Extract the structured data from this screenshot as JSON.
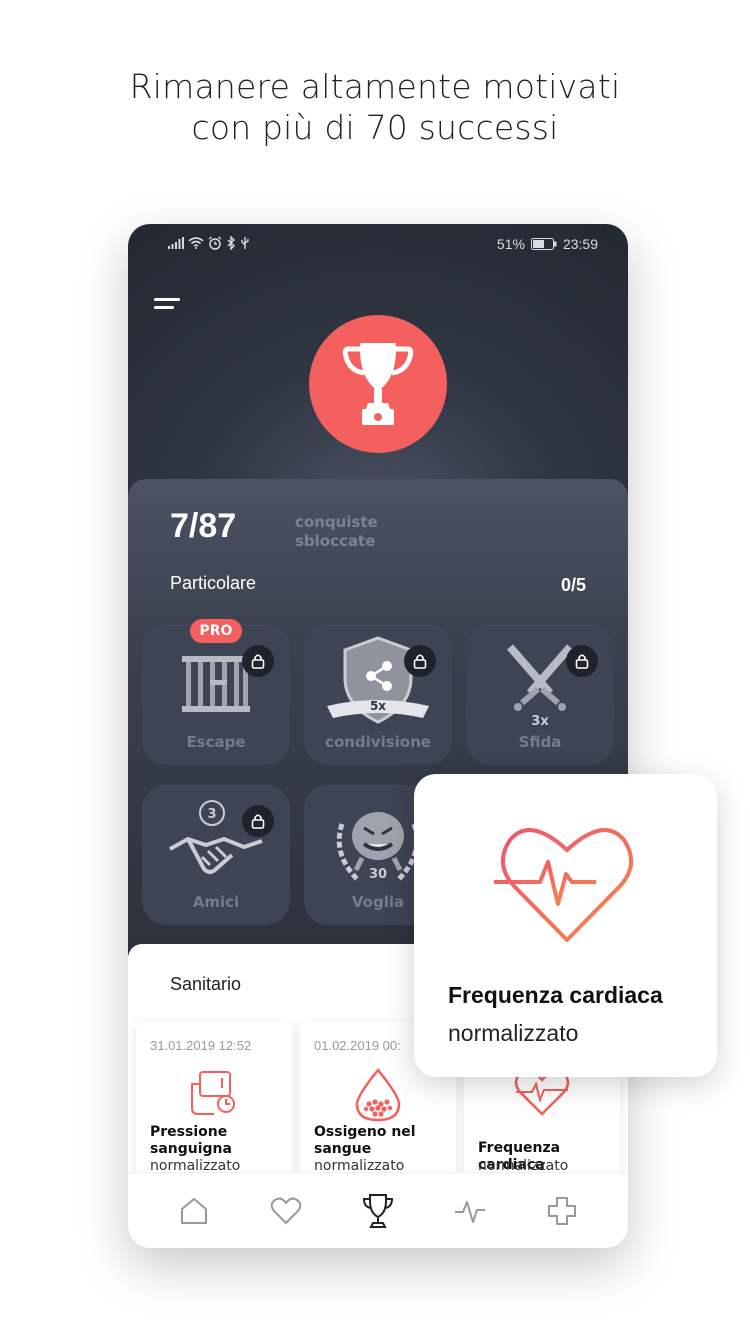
{
  "headline": {
    "line1": "Rimanere altamente motivati",
    "line2": "con più di 70 successi"
  },
  "status_bar": {
    "battery": "51%",
    "time": "23:59"
  },
  "achievements": {
    "count": "7/87",
    "count_label": "conquiste sbloccate",
    "section_title": "Particolare",
    "section_count": "0/5",
    "badges": [
      {
        "name": "Escape",
        "pro_label": "PRO",
        "locked": true
      },
      {
        "name": "condivisione",
        "multiplier": "5x",
        "locked": true
      },
      {
        "name": "Sfida",
        "multiplier": "3x",
        "locked": true
      },
      {
        "name": "Amici",
        "count": "3",
        "locked": true
      },
      {
        "name": "Voglia",
        "count": "30",
        "locked": true
      }
    ]
  },
  "health": {
    "title": "Sanitario",
    "cards": [
      {
        "date": "31.01.2019 12:52",
        "title": "Pressione sanguigna",
        "subtitle": "normalizzato",
        "icon": "blood-pressure-icon"
      },
      {
        "date": "01.02.2019 00:",
        "title": "Ossigeno nel sangue",
        "subtitle": "normalizzato",
        "icon": "blood-drop-icon"
      },
      {
        "date": "",
        "title": "Frequenza cardiaca",
        "subtitle": "normalizzato",
        "icon": "heart-rate-icon"
      }
    ]
  },
  "overlay": {
    "title": "Frequenza cardiaca",
    "subtitle": "normalizzato"
  },
  "tabbar": [
    "home-tab",
    "heart-tab",
    "trophy-tab",
    "activity-tab",
    "health-plus-tab"
  ],
  "colors": {
    "accent": "#f3605d",
    "dark_bg": "#2f3541",
    "badge_bg": "#3e4453"
  }
}
